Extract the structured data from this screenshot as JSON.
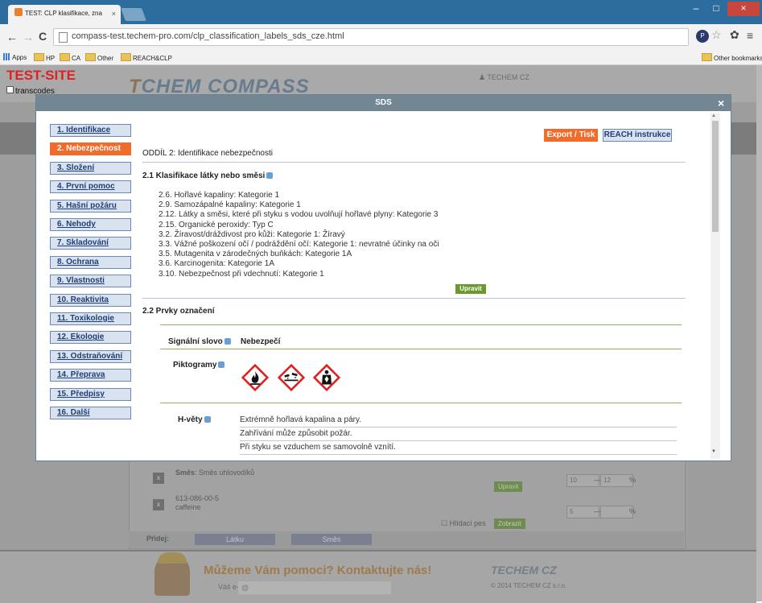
{
  "browser": {
    "tab_title": "TEST: CLP klasifikace, zna",
    "tab_close": "×",
    "url": "compass-test.techem-pro.com/clp_classification_labels_sds_cze.html",
    "window_min": "–",
    "window_max": "□",
    "window_close": "×",
    "bookmarks": [
      "Apps",
      "HP",
      "CA",
      "Other",
      "REACH&CLP"
    ],
    "other_bookmarks": "Other bookmarks"
  },
  "page": {
    "test_site": "TEST-SITE",
    "transcodes": "transcodes",
    "logo_prefix": "T",
    "logo_rest": "CHEM COMPASS",
    "user": "TECHEM CZ",
    "bg_rows": {
      "row1_label": "Směs",
      "row1_value": "Směs uhlovodíků",
      "row1_btn": "Upravit",
      "row1_min": "10",
      "row1_max": "12",
      "row2_code": "613-086-00-5",
      "row2_name": "caffeine",
      "row2_check": "Hlídací pes",
      "row2_btn": "Zobrazit",
      "row2_min": "5",
      "percent": "%",
      "dash": "—",
      "x_label": "x"
    },
    "add_label": "Přidej:",
    "add_substance": "Látku",
    "add_mixture": "Směs",
    "help_text": "Můžeme Vám pomoci? Kontaktujte nás!",
    "email_label": "Váš e-mail:",
    "email_placeholder": "@",
    "footer_logo": "TECHEM CZ",
    "footer_copy": "© 2014 TECHEM CZ s.r.o."
  },
  "modal": {
    "title": "SDS",
    "close": "×",
    "sidebar": [
      "1. Identifikace",
      "2. Nebezpečnost",
      "3. Složení",
      "4. První pomoc",
      "5. Hašní požáru",
      "6. Nehody",
      "7. Skladování",
      "8. Ochrana",
      "9. Vlastnosti",
      "10. Reaktivita",
      "11. Toxikologie",
      "12. Ekologie",
      "13. Odstraňování",
      "14. Přeprava",
      "15. Předpisy",
      "16. Další"
    ],
    "active_index": 1,
    "export_btn": "Export / Tisk",
    "reach_btn": "REACH instrukce",
    "section_title": "ODDÍL 2: Identifikace nebezpečnosti",
    "sub1": "2.1 Klasifikace látky nebo směsi",
    "hazards": [
      "2.6. Hořlavé kapaliny: Kategorie 1",
      "2.9. Samozápalné kapaliny: Kategorie 1",
      "2.12. Látky a směsi, které při styku s vodou uvolňují hořlavé plyny: Kategorie 3",
      "2.15. Organické peroxidy: Typ C",
      "3.2. Žíravost/dráždivost pro kůži: Kategorie 1: Žíravý",
      "3.3. Vážné poškození očí / podráždění očí: Kategorie 1: nevratné účinky na oči",
      "3.5. Mutagenita v zárodečných buňkách: Kategorie 1A",
      "3.6. Karcinogenita: Kategorie 1A",
      "3.10. Nebezpečnost při vdechnutí: Kategorie 1"
    ],
    "edit_btn": "Upravit",
    "sub2": "2.2 Prvky označení",
    "signal_label": "Signální slovo",
    "signal_value": "Nebezpečí",
    "picto_label": "Piktogramy",
    "h_label": "H-věty",
    "h_statements": [
      "Extrémně hořlavá kapalina a páry.",
      "Zahřívání může způsobit požár.",
      "Při styku se vzduchem se samovolně vznítí."
    ]
  },
  "colors": {
    "accent": "#ef6c2b",
    "nav_blue": "#1f3d74",
    "green": "#6a9a2f",
    "header": "#728694",
    "hazard_red": "#e02020"
  },
  "icons": [
    "flame-pictogram-icon",
    "corrosion-pictogram-icon",
    "health-hazard-pictogram-icon"
  ]
}
